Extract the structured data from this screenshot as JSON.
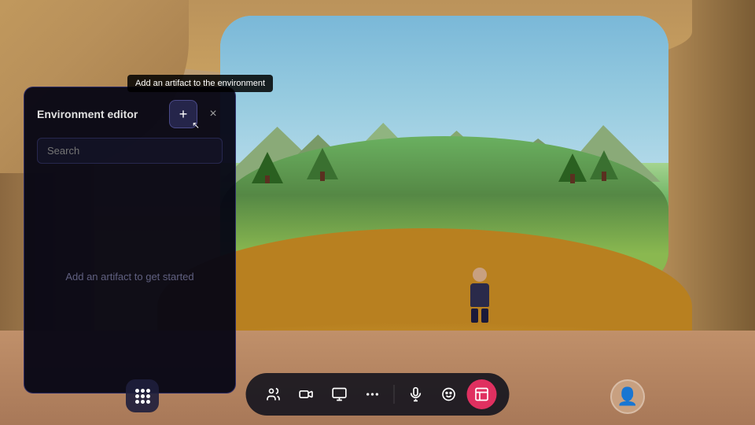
{
  "environment": {
    "bg_description": "3D virtual environment with sandy arched room and green landscape outside"
  },
  "tooltip": {
    "text": "Add an artifact to the environment"
  },
  "editor_panel": {
    "title": "Environment editor",
    "add_button_label": "+",
    "close_button_label": "×",
    "search_placeholder": "Search",
    "empty_state_text": "Add an artifact to get started"
  },
  "toolbar": {
    "buttons": [
      {
        "id": "people",
        "icon": "people",
        "label": "People",
        "active": false
      },
      {
        "id": "camera",
        "icon": "camera",
        "label": "Camera",
        "active": false
      },
      {
        "id": "screen",
        "icon": "screen-share",
        "label": "Screen share",
        "active": false
      },
      {
        "id": "more",
        "icon": "more",
        "label": "More",
        "active": false
      },
      {
        "id": "mic",
        "icon": "microphone",
        "label": "Microphone",
        "active": false
      },
      {
        "id": "emoji",
        "icon": "emoji",
        "label": "Emoji",
        "active": false
      },
      {
        "id": "artifact",
        "icon": "artifact",
        "label": "Artifact",
        "active": true
      }
    ],
    "left_button": {
      "id": "grid",
      "label": "Grid"
    },
    "right_avatar": {
      "id": "user-avatar",
      "label": "User avatar"
    }
  }
}
